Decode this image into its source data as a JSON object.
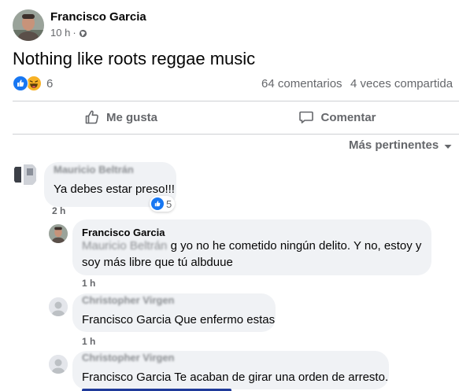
{
  "post": {
    "author": "Francisco Garcia",
    "time": "10 h",
    "privacy_dot": "·",
    "text": "Nothing like roots reggae music",
    "reaction_count": "6",
    "comments_count": "64 comentarios",
    "shares_count": "4 veces compartida"
  },
  "actions": {
    "like": "Me gusta",
    "comment": "Comentar"
  },
  "sort": {
    "label": "Más pertinentes"
  },
  "comments": [
    {
      "author": "Mauricio Beltrán",
      "text": "Ya debes estar preso!!!",
      "time": "2 h",
      "reactions": "5"
    },
    {
      "author": "Francisco Garcia",
      "mention": "Mauricio Beltrán",
      "text_line1": "g yo no he cometido ningún delito. Y no, estoy y",
      "text_line2": "soy más libre que tú albduue",
      "time": "1 h"
    },
    {
      "author": "Christopher Virgen",
      "text": "Francisco Garcia Que enfermo estas",
      "time": "1 h"
    },
    {
      "author": "Christopher Virgen",
      "text": "Francisco Garcia Te acaban de girar una orden de arresto."
    }
  ],
  "colors": {
    "like_blue": "#1877f2",
    "haha_yellow": "#f7b125",
    "bubble": "#f0f2f5",
    "secondary_text": "#65676b"
  }
}
